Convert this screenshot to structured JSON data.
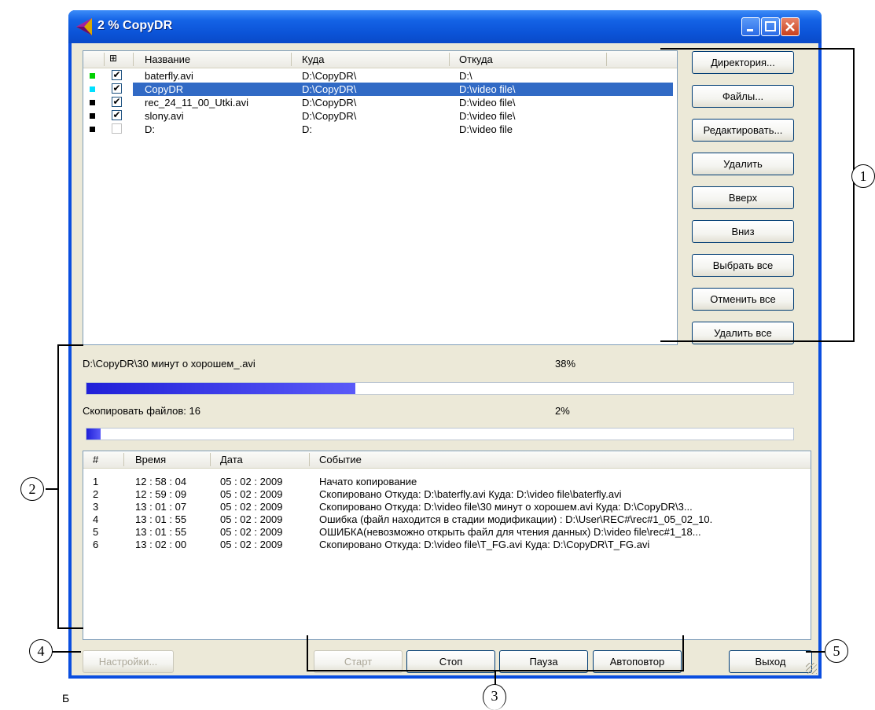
{
  "window": {
    "title": "2 % CopyDR",
    "colors": {
      "titlebar": "#0b53d7",
      "selection": "#316ac5",
      "progress": "#2020d8"
    }
  },
  "filelist": {
    "headers": {
      "expand": "⊞",
      "name": "Название",
      "to": "Куда",
      "from": "Откуда"
    },
    "rows": [
      {
        "status_color": "#00d000",
        "checked": "✔",
        "name": "baterfly.avi",
        "to": "D:\\CopyDR\\",
        "from": "D:\\"
      },
      {
        "status_color": "#00e0ff",
        "checked": "✔",
        "name": "CopyDR",
        "to": "D:\\CopyDR\\",
        "from": "D:\\video file\\"
      },
      {
        "status_color": "#000000",
        "checked": "✔",
        "name": "rec_24_11_00_Utki.avi",
        "to": "D:\\CopyDR\\",
        "from": "D:\\video file\\"
      },
      {
        "status_color": "#000000",
        "checked": "✔",
        "name": "slony.avi",
        "to": "D:\\CopyDR\\",
        "from": "D:\\video file\\"
      },
      {
        "status_color": "#000000",
        "checked": "",
        "name": "D:",
        "to": "D:",
        "from": "D:\\video file"
      }
    ]
  },
  "side_buttons": {
    "directory": "Директория...",
    "files": "Файлы...",
    "edit": "Редактировать...",
    "delete": "Удалить",
    "up": "Вверх",
    "down": "Вниз",
    "select_all": "Выбрать все",
    "deselect_all": "Отменить все",
    "delete_all": "Удалить все"
  },
  "progress": {
    "current_file": "D:\\CopyDR\\30 минут о хорошем_.avi",
    "current_percent": "38%",
    "current_value": 0.38,
    "total_label": "Скопировать файлов: 16",
    "total_percent": "2%",
    "total_value": 0.02
  },
  "log": {
    "headers": {
      "num": "#",
      "time": "Время",
      "date": "Дата",
      "event": "Событие"
    },
    "rows": [
      {
        "num": "1",
        "time": "12 : 58 : 04",
        "date": "05 : 02 : 2009",
        "event": "Начато копирование"
      },
      {
        "num": "2",
        "time": "12 : 59 : 09",
        "date": "05 : 02 : 2009",
        "event": "Скопировано  Откуда: D:\\baterfly.avi  Куда: D:\\video file\\baterfly.avi"
      },
      {
        "num": "3",
        "time": "13 : 01 : 07",
        "date": "05 : 02 : 2009",
        "event": "Скопировано  Откуда: D:\\video file\\30 минут о хорошем.avi  Куда: D:\\CopyDR\\3..."
      },
      {
        "num": "4",
        "time": "13 : 01 : 55",
        "date": "05 : 02 : 2009",
        "event": "Ошибка (файл находится в стадии модификации) : D:\\User\\REC#\\rec#1_05_02_10."
      },
      {
        "num": "5",
        "time": "13 : 01 : 55",
        "date": "05 : 02 : 2009",
        "event": "ОШИБКА(невозможно открыть файл для чтения данных)  D:\\video file\\rec#1_18..."
      },
      {
        "num": "6",
        "time": "13 : 02 : 00",
        "date": "05 : 02 : 2009",
        "event": "Скопировано  Откуда: D:\\video file\\T_FG.avi  Куда: D:\\CopyDR\\T_FG.avi"
      }
    ]
  },
  "bottom_buttons": {
    "settings": "Настройки...",
    "start": "Старт",
    "stop": "Стоп",
    "pause": "Пауза",
    "autorepeat": "Автоповтор",
    "exit": "Выход"
  },
  "annotations": {
    "c1": "1",
    "c2": "2",
    "c3": "3",
    "c4": "4",
    "c5": "5"
  },
  "caption": "Б"
}
